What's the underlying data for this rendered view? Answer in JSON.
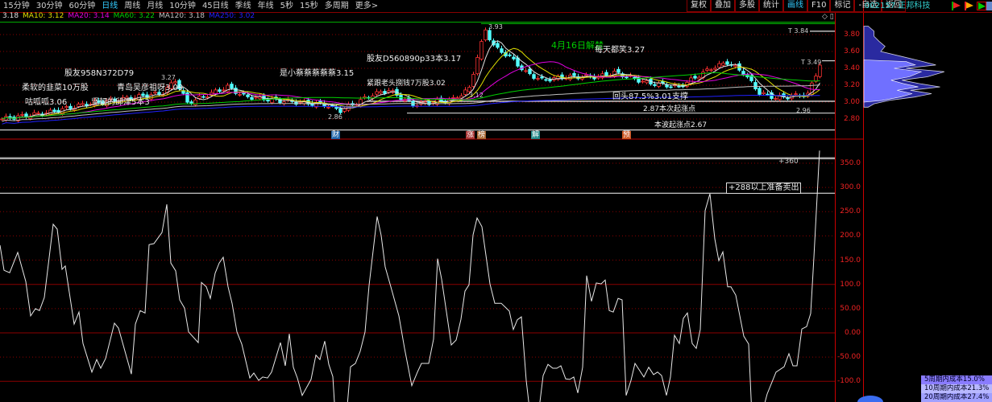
{
  "menu": {
    "periods": [
      "15分钟",
      "30分钟",
      "60分钟",
      "日线",
      "周线",
      "月线",
      "10分钟",
      "45日线",
      "季线",
      "年线",
      "5秒",
      "15秒",
      "多周期",
      "更多>"
    ],
    "active": "日线"
  },
  "ma_legend": [
    {
      "label": "3.18",
      "color": "#e0e0e0"
    },
    {
      "label": "MA10: 3.12",
      "color": "#e0e000"
    },
    {
      "label": "MA20: 3.14",
      "color": "#e000e0"
    },
    {
      "label": "MA60: 3.22",
      "color": "#00d000"
    },
    {
      "label": "MA120: 3.18",
      "color": "#c0c0c0"
    },
    {
      "label": "MA250: 3.02",
      "color": "#2020ff"
    }
  ],
  "toolbar": [
    "复权",
    "叠加",
    "多股",
    "统计",
    "画线",
    "F10",
    "标记",
    "-自选",
    "返回"
  ],
  "toolbar_active": "画线",
  "stock": {
    "code_name": "002157 正邦科技"
  },
  "annotations": {
    "a1": "股友958N372D79",
    "a2": "柔软的韭菜10万股",
    "a3": "青岛吴彦祖呀3.09",
    "a4": "坚韧的邱津5本3",
    "a5": "咕呱呱3.06",
    "a6": "是小蔡蔡蔡蔡蔡3.15",
    "a7": "股友D560890p33本3.17",
    "a8": "紧跟老头捌钱7万股3.02",
    "a9": "4月16日解禁",
    "a10": "每天都笑3.27",
    "a11": "回头87.5%3.01支撑",
    "a12": "2.87本次起涨点",
    "a13": "本波起涨点2.67",
    "p1": "3.27",
    "p2": "3.12",
    "p3": "3.93",
    "p4": "2.86",
    "p5": "2.96",
    "t1": "T 3.84",
    "t2": "T 3.49",
    "l1": "+360",
    "l2": "+288以上准备卖出"
  },
  "markers": [
    {
      "label": "财",
      "color": "#26a"
    },
    {
      "label": "涨",
      "color": "#a33"
    },
    {
      "label": "榜",
      "color": "#a63"
    },
    {
      "label": "解",
      "color": "#288"
    },
    {
      "label": "预",
      "color": "#c52"
    }
  ],
  "cost_labels": [
    "5周期内成本15.0%",
    "10周期内成本21.3%",
    "20周期内成本27.4%"
  ],
  "colors": {
    "up": "#ff3232",
    "down": "#54ffff",
    "grid": "#8b0000",
    "axis": "#e22"
  },
  "chart_data": [
    {
      "type": "candlestick",
      "title": "日线",
      "y_ticks": [
        "3.80",
        "3.60",
        "3.40",
        "3.20",
        "3.00",
        "2.80"
      ],
      "ylim": [
        2.6,
        3.95
      ],
      "close_path": [
        [
          0,
          2.8
        ],
        [
          12,
          2.88
        ],
        [
          20,
          2.97
        ],
        [
          28,
          3.02
        ],
        [
          40,
          3.11
        ],
        [
          43,
          3.26
        ],
        [
          46,
          2.99
        ],
        [
          56,
          3.18
        ],
        [
          60,
          3.07
        ],
        [
          68,
          3.02
        ],
        [
          80,
          2.97
        ],
        [
          84,
          2.9
        ],
        [
          92,
          3.09
        ],
        [
          96,
          3.14
        ],
        [
          102,
          2.97
        ],
        [
          112,
          3.03
        ],
        [
          116,
          3.16
        ],
        [
          118,
          3.54
        ],
        [
          120,
          3.85
        ],
        [
          122.4,
          3.64
        ],
        [
          126,
          3.54
        ],
        [
          130,
          3.35
        ],
        [
          134,
          3.26
        ],
        [
          140,
          3.3
        ],
        [
          148,
          3.3
        ],
        [
          152,
          3.35
        ],
        [
          160,
          3.23
        ],
        [
          168,
          3.18
        ],
        [
          176,
          3.4
        ],
        [
          180,
          3.47
        ],
        [
          184,
          3.35
        ],
        [
          188,
          3.11
        ],
        [
          192,
          3.05
        ],
        [
          200,
          3.09
        ],
        [
          203,
          3.45
        ]
      ],
      "levels": [
        {
          "price": 3.93,
          "color": "#0a0"
        },
        {
          "price": 3.84,
          "color": "#ccc"
        },
        {
          "price": 3.49,
          "color": "#ccc"
        },
        {
          "price": 3.01,
          "color": "#ddd"
        },
        {
          "price": 2.87,
          "color": "#bbb"
        },
        {
          "price": 2.67,
          "color": "#ccc"
        }
      ],
      "volume_profile": [
        [
          3.9,
          0.05
        ],
        [
          3.84,
          0.12
        ],
        [
          3.78,
          0.12
        ],
        [
          3.72,
          0.18
        ],
        [
          3.66,
          0.25
        ],
        [
          3.6,
          0.2
        ],
        [
          3.54,
          0.45
        ],
        [
          3.48,
          0.7
        ],
        [
          3.44,
          0.85
        ],
        [
          3.4,
          0.5
        ],
        [
          3.36,
          0.95
        ],
        [
          3.3,
          0.75
        ],
        [
          3.26,
          0.45
        ],
        [
          3.22,
          0.65
        ],
        [
          3.18,
          0.9
        ],
        [
          3.14,
          0.55
        ],
        [
          3.1,
          0.8
        ],
        [
          3.06,
          0.6
        ],
        [
          3.02,
          0.3
        ],
        [
          2.98,
          0.12
        ],
        [
          2.94,
          0.05
        ]
      ]
    },
    {
      "type": "line",
      "series_name": "indicator",
      "y_ticks": [
        "350.0",
        "300.0",
        "250.0",
        "200.0",
        "150.0",
        "100.0",
        "50.00",
        "0.00",
        "-50.00",
        "-100.0"
      ],
      "ylim": [
        -140,
        390
      ],
      "reference_lines": [
        360,
        288
      ],
      "points": [
        [
          0,
          181
        ],
        [
          1,
          129
        ],
        [
          2.4,
          124
        ],
        [
          4.4,
          166
        ],
        [
          6.4,
          106
        ],
        [
          7.6,
          35
        ],
        [
          8.8,
          50
        ],
        [
          9.8,
          46
        ],
        [
          11,
          73
        ],
        [
          13.2,
          224
        ],
        [
          14.2,
          214
        ],
        [
          15.4,
          131
        ],
        [
          16.2,
          138
        ],
        [
          18.4,
          18
        ],
        [
          19.6,
          43
        ],
        [
          20.6,
          -22
        ],
        [
          22.8,
          -81
        ],
        [
          24,
          -55
        ],
        [
          25,
          -73
        ],
        [
          26.2,
          -53
        ],
        [
          28.4,
          20
        ],
        [
          29.4,
          10
        ],
        [
          32.6,
          -85
        ],
        [
          33.6,
          18
        ],
        [
          34.8,
          46
        ],
        [
          36,
          41
        ],
        [
          37,
          182
        ],
        [
          38.2,
          184
        ],
        [
          40.2,
          207
        ],
        [
          41.4,
          265
        ],
        [
          42.4,
          144
        ],
        [
          43.6,
          128
        ],
        [
          44.6,
          68
        ],
        [
          45.8,
          51
        ],
        [
          46.8,
          2
        ],
        [
          49.2,
          -20
        ],
        [
          50,
          104
        ],
        [
          51.2,
          95
        ],
        [
          52.2,
          71
        ],
        [
          53.4,
          123
        ],
        [
          54.4,
          144
        ],
        [
          55.4,
          156
        ],
        [
          56.6,
          95
        ],
        [
          57.6,
          61
        ],
        [
          58.8,
          2
        ],
        [
          60,
          -23
        ],
        [
          62,
          -93
        ],
        [
          63,
          -83
        ],
        [
          64.2,
          -98
        ],
        [
          65.2,
          -91
        ],
        [
          66.4,
          -93
        ],
        [
          67.4,
          -81
        ],
        [
          69.6,
          -20
        ],
        [
          70.8,
          -68
        ],
        [
          71.8,
          -2
        ],
        [
          72.8,
          -71
        ],
        [
          73.8,
          -93
        ],
        [
          75,
          -129
        ],
        [
          77.2,
          -96
        ],
        [
          78.4,
          -46
        ],
        [
          79.4,
          -55
        ],
        [
          80.6,
          -17
        ],
        [
          81.6,
          -65
        ],
        [
          82.6,
          -90
        ],
        [
          83.2,
          -170
        ],
        [
          86,
          -170
        ],
        [
          87,
          -70
        ],
        [
          88.2,
          -63
        ],
        [
          89.4,
          -38
        ],
        [
          90.6,
          2
        ],
        [
          91.6,
          98
        ],
        [
          93.6,
          240
        ],
        [
          94.6,
          201
        ],
        [
          95.6,
          136
        ],
        [
          97,
          95
        ],
        [
          99,
          35
        ],
        [
          100.4,
          -32
        ],
        [
          102.2,
          -109
        ],
        [
          103.6,
          -81
        ],
        [
          104.6,
          -63
        ],
        [
          106.4,
          -63
        ],
        [
          107.6,
          -13
        ],
        [
          108.6,
          153
        ],
        [
          109.6,
          111
        ],
        [
          111,
          32
        ],
        [
          112,
          -25
        ],
        [
          113.2,
          -15
        ],
        [
          114.4,
          28
        ],
        [
          115.4,
          86
        ],
        [
          116.4,
          99
        ],
        [
          117.4,
          202
        ],
        [
          118.4,
          237
        ],
        [
          119.6,
          219
        ],
        [
          121.6,
          101
        ],
        [
          122.8,
          61
        ],
        [
          124.4,
          61
        ],
        [
          126.4,
          45
        ],
        [
          127.4,
          7
        ],
        [
          128.4,
          27
        ],
        [
          129.4,
          33
        ],
        [
          130.6,
          -98
        ],
        [
          131.6,
          -170
        ],
        [
          133.6,
          -170
        ],
        [
          134.8,
          -88
        ],
        [
          136,
          -65
        ],
        [
          137.2,
          -73
        ],
        [
          138.2,
          -73
        ],
        [
          139.2,
          -68
        ],
        [
          140.4,
          -95
        ],
        [
          141.4,
          -96
        ],
        [
          142.4,
          -91
        ],
        [
          143.4,
          -124
        ],
        [
          144.6,
          -71
        ],
        [
          145.6,
          118
        ],
        [
          146.8,
          65
        ],
        [
          148,
          103
        ],
        [
          149.2,
          101
        ],
        [
          150.2,
          109
        ],
        [
          151.2,
          46
        ],
        [
          152.2,
          43
        ],
        [
          153.4,
          71
        ],
        [
          154.4,
          68
        ],
        [
          155.4,
          -129
        ],
        [
          156.6,
          -98
        ],
        [
          157.6,
          -63
        ],
        [
          159.8,
          -91
        ],
        [
          161,
          -71
        ],
        [
          162.2,
          -86
        ],
        [
          163.2,
          -81
        ],
        [
          164.2,
          -88
        ],
        [
          165.4,
          -129
        ],
        [
          166.4,
          -91
        ],
        [
          167.4,
          -5
        ],
        [
          168.6,
          -22
        ],
        [
          169.6,
          30
        ],
        [
          170.6,
          41
        ],
        [
          171.8,
          -22
        ],
        [
          172.8,
          -32
        ],
        [
          173.8,
          7
        ],
        [
          175,
          252
        ],
        [
          176.2,
          287
        ],
        [
          177.4,
          194
        ],
        [
          178.4,
          149
        ],
        [
          179.4,
          167
        ],
        [
          180.6,
          95
        ],
        [
          181.4,
          95
        ],
        [
          182.6,
          78
        ],
        [
          184.6,
          -7
        ],
        [
          185.8,
          -23
        ],
        [
          186.6,
          -170
        ],
        [
          189,
          -170
        ],
        [
          190.4,
          -126
        ],
        [
          192.6,
          -81
        ],
        [
          194.6,
          -70
        ],
        [
          195.8,
          -43
        ],
        [
          196.8,
          -68
        ],
        [
          197.8,
          -68
        ],
        [
          199,
          8
        ],
        [
          200.2,
          13
        ],
        [
          201.2,
          40
        ],
        [
          202,
          156
        ],
        [
          203.4,
          376
        ]
      ]
    }
  ]
}
